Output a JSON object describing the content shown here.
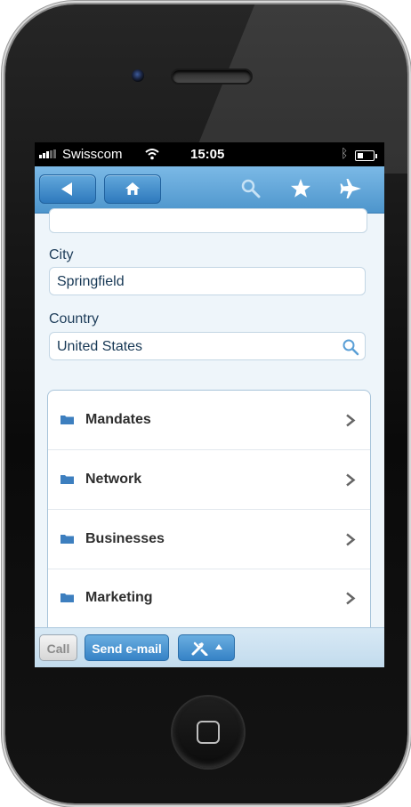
{
  "status_bar": {
    "carrier": "Swisscom",
    "time": "15:05"
  },
  "nav_bar": {
    "icons": [
      "back-arrow-icon",
      "home-icon",
      "search-icon",
      "star-icon",
      "airplane-icon"
    ]
  },
  "form": {
    "city": {
      "label": "City",
      "value": "Springfield"
    },
    "country": {
      "label": "Country",
      "value": "United States"
    }
  },
  "list": {
    "items": [
      {
        "label": "Mandates",
        "icon": "folder-icon"
      },
      {
        "label": "Network",
        "icon": "folder-icon"
      },
      {
        "label": "Businesses",
        "icon": "folder-icon"
      },
      {
        "label": "Marketing",
        "icon": "folder-icon"
      }
    ]
  },
  "toolbar": {
    "call_label": "Call",
    "email_label": "Send e-mail"
  },
  "colors": {
    "accent": "#4d95cc",
    "background": "#eef5fa"
  }
}
